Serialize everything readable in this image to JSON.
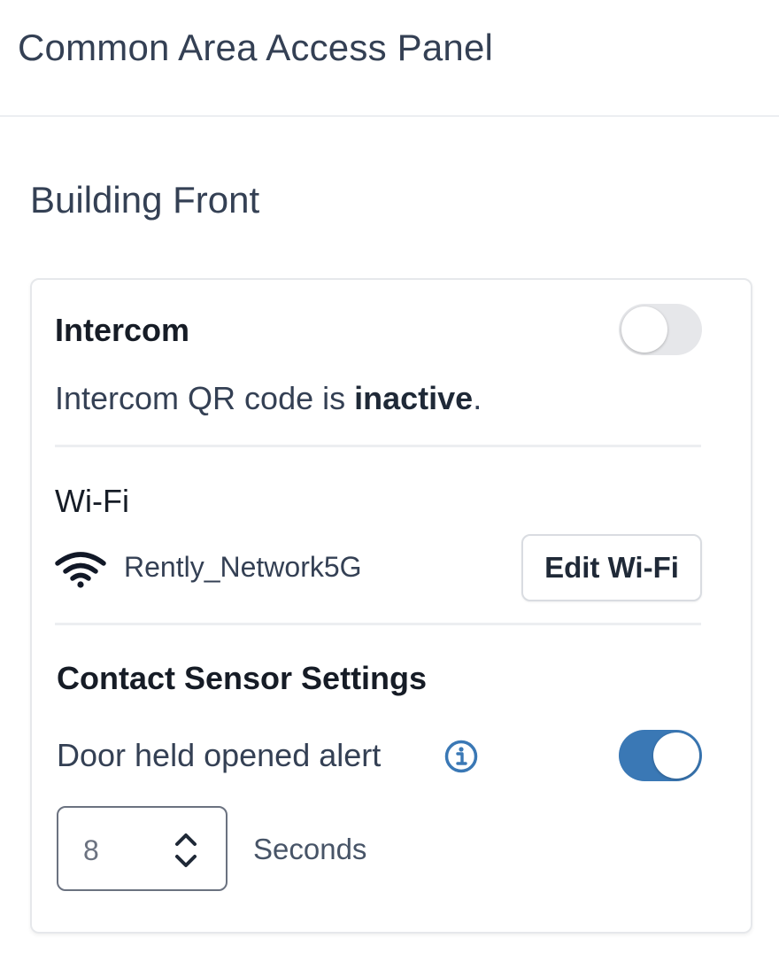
{
  "header": {
    "title": "Common Area Access Panel"
  },
  "section": {
    "title": "Building Front"
  },
  "intercom": {
    "heading": "Intercom",
    "toggle_on": false,
    "status_prefix": "Intercom QR code is ",
    "status_value": "inactive",
    "status_suffix": "."
  },
  "wifi": {
    "heading": "Wi-Fi",
    "icon": "wifi-icon",
    "network_name": "Rently_Network5G",
    "edit_label": "Edit Wi-Fi"
  },
  "contact_sensor": {
    "heading": "Contact Sensor Settings",
    "door_alert_label": "Door held opened alert",
    "info_icon": "info-icon",
    "door_alert_on": true,
    "seconds_value": "8",
    "seconds_unit": "Seconds"
  },
  "colors": {
    "accent": "#3a78b5",
    "toggle_off": "#e6e7ea",
    "text": "#344054"
  }
}
